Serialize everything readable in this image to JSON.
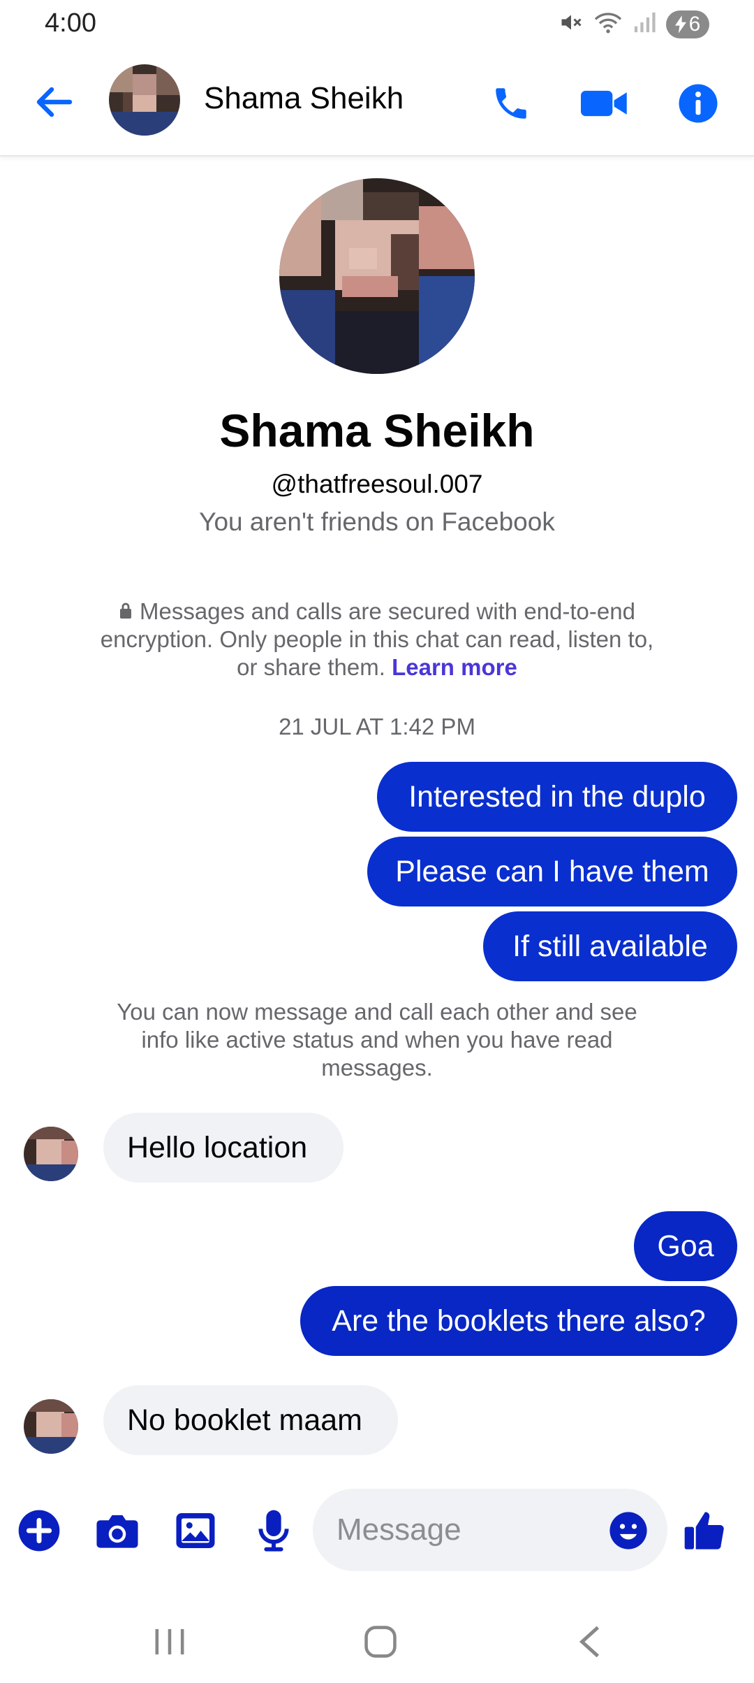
{
  "status_bar": {
    "time": "4:00",
    "battery_level": "6",
    "icons": [
      "mute-icon",
      "wifi-icon",
      "signal-icon",
      "battery-charging-icon"
    ]
  },
  "header": {
    "contact_name": "Shama Sheikh",
    "icons": [
      "back-arrow-icon",
      "phone-icon",
      "video-camera-icon",
      "info-icon"
    ]
  },
  "profile": {
    "name": "Shama Sheikh",
    "handle": "@thatfreesoul.007",
    "friend_status": "You aren't friends on Facebook"
  },
  "encryption_notice": {
    "text": "Messages and calls are secured with end-to-end encryption. Only people in this chat can read, listen to, or share them.",
    "link": "Learn more"
  },
  "timestamp": "21 JUL AT 1:42 PM",
  "messages": [
    {
      "direction": "outgoing",
      "text": "Interested in the duplo"
    },
    {
      "direction": "outgoing",
      "text": "Please can I have them"
    },
    {
      "direction": "outgoing",
      "text": "If still available"
    },
    {
      "direction": "incoming",
      "text": "Hello location"
    },
    {
      "direction": "outgoing",
      "text": "Goa"
    },
    {
      "direction": "outgoing",
      "text": "Are the booklets there also?"
    },
    {
      "direction": "incoming",
      "text": "No booklet maam"
    }
  ],
  "system_note": "You can now message and call each other and see info like active status and when you have read messages.",
  "composer": {
    "placeholder": "Message",
    "icons": [
      "plus-icon",
      "camera-icon",
      "gallery-icon",
      "microphone-icon",
      "emoji-icon",
      "thumbs-up-icon"
    ]
  },
  "colors": {
    "accent": "#0866ff",
    "outgoing_bubble": "#0a2fcf",
    "composer_icons": "#0a1fc0",
    "incoming_bubble": "#f0f2f5",
    "secondary_text": "#65676b",
    "link": "#4a36d8"
  }
}
